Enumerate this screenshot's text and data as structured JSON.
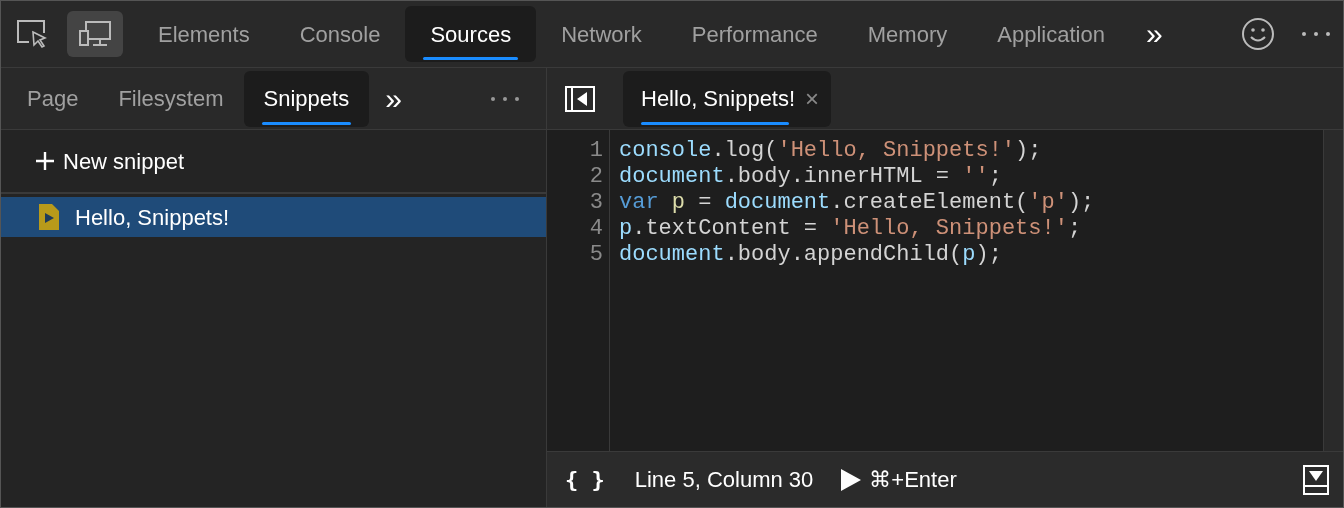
{
  "main_tabs": [
    {
      "label": "Elements",
      "selected": false
    },
    {
      "label": "Console",
      "selected": false
    },
    {
      "label": "Sources",
      "selected": true
    },
    {
      "label": "Network",
      "selected": false
    },
    {
      "label": "Performance",
      "selected": false
    },
    {
      "label": "Memory",
      "selected": false
    },
    {
      "label": "Application",
      "selected": false
    }
  ],
  "main_tabs_overflow": "»",
  "device_toolbar": {
    "on": true
  },
  "navigator": {
    "tabs": [
      {
        "label": "Page",
        "selected": false
      },
      {
        "label": "Filesystem",
        "selected": false
      },
      {
        "label": "Snippets",
        "selected": true
      }
    ],
    "overflow": "»",
    "new_snippet": "New snippet",
    "items": [
      {
        "label": "Hello, Snippets!",
        "selected": true
      }
    ]
  },
  "editor": {
    "tabs": [
      {
        "label": "Hello, Snippets!",
        "selected": true,
        "close": "×"
      }
    ],
    "lines": [
      {
        "number": "1",
        "tokens": [
          {
            "kind": "ident",
            "text": "console"
          },
          {
            "kind": "plain",
            "text": ".log("
          },
          {
            "kind": "string",
            "text": "'Hello, Snippets!'"
          },
          {
            "kind": "plain",
            "text": ");"
          }
        ]
      },
      {
        "number": "2",
        "tokens": [
          {
            "kind": "ident",
            "text": "document"
          },
          {
            "kind": "plain",
            "text": ".body.innerHTML = "
          },
          {
            "kind": "string",
            "text": "''"
          },
          {
            "kind": "plain",
            "text": ";"
          }
        ]
      },
      {
        "number": "3",
        "tokens": [
          {
            "kind": "keyword",
            "text": "var "
          },
          {
            "kind": "local",
            "text": "p"
          },
          {
            "kind": "plain",
            "text": " = "
          },
          {
            "kind": "ident",
            "text": "document"
          },
          {
            "kind": "plain",
            "text": ".createElement("
          },
          {
            "kind": "string",
            "text": "'p'"
          },
          {
            "kind": "plain",
            "text": ");"
          }
        ]
      },
      {
        "number": "4",
        "tokens": [
          {
            "kind": "ident",
            "text": "p"
          },
          {
            "kind": "plain",
            "text": ".textContent = "
          },
          {
            "kind": "string",
            "text": "'Hello, Snippets!'"
          },
          {
            "kind": "plain",
            "text": ";"
          }
        ]
      },
      {
        "number": "5",
        "tokens": [
          {
            "kind": "ident",
            "text": "document"
          },
          {
            "kind": "plain",
            "text": ".body.appendChild("
          },
          {
            "kind": "ident",
            "text": "p"
          },
          {
            "kind": "plain",
            "text": ");"
          }
        ]
      }
    ]
  },
  "status_bar": {
    "pretty_print": "{ }",
    "position": "Line 5, Column 30",
    "run_shortcut": "⌘+Enter"
  }
}
